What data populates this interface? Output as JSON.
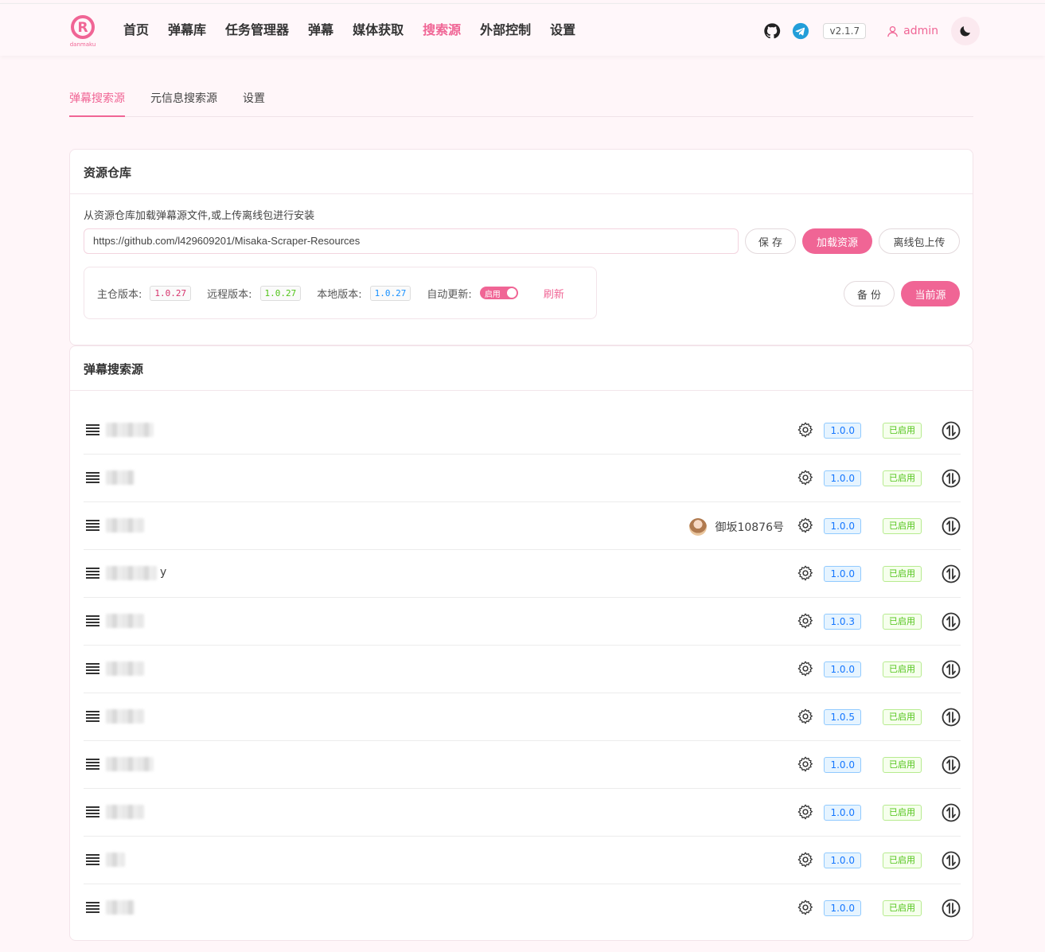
{
  "header": {
    "logo_text": "danmaku",
    "nav": [
      "首页",
      "弹幕库",
      "任务管理器",
      "弹幕",
      "媒体获取",
      "搜索源",
      "外部控制",
      "设置"
    ],
    "active_nav": 5,
    "version": "v2.1.7",
    "user": "admin",
    "icons": [
      "github-icon",
      "telegram-icon",
      "user-icon",
      "moon-icon"
    ]
  },
  "subtabs": [
    "弹幕搜索源",
    "元信息搜索源",
    "设置"
  ],
  "repo": {
    "title": "资源仓库",
    "desc": "从资源仓库加载弹幕源文件,或上传离线包进行安装",
    "url": "https://github.com/l429609201/Misaka-Scraper-Resources",
    "save": "保 存",
    "load": "加载资源",
    "upload": "离线包上传",
    "main_version_label": "主仓版本:",
    "main_version": "1.0.27",
    "remote_version_label": "远程版本:",
    "remote_version": "1.0.27",
    "local_version_label": "本地版本:",
    "local_version": "1.0.27",
    "auto_update_label": "自动更新:",
    "auto_update": "启用",
    "refresh": "刷新",
    "backup": "备 份",
    "current": "当前源"
  },
  "list": {
    "title": "弹幕搜索源",
    "rows": [
      {
        "version": "1.0.0",
        "status": "已启用"
      },
      {
        "version": "1.0.0",
        "status": "已启用"
      },
      {
        "version": "1.0.0",
        "status": "已启用",
        "author": "御坂10876号"
      },
      {
        "version": "1.0.0",
        "status": "已启用",
        "suffix": "y"
      },
      {
        "version": "1.0.3",
        "status": "已启用"
      },
      {
        "version": "1.0.0",
        "status": "已启用"
      },
      {
        "version": "1.0.5",
        "status": "已启用"
      },
      {
        "version": "1.0.0",
        "status": "已启用"
      },
      {
        "version": "1.0.0",
        "status": "已启用"
      },
      {
        "version": "1.0.0",
        "status": "已启用"
      },
      {
        "version": "1.0.0",
        "status": "已启用"
      }
    ]
  },
  "colors": {
    "accent": "#f06595",
    "tag_blue": "#1677ff",
    "tag_green": "#52c41a"
  }
}
